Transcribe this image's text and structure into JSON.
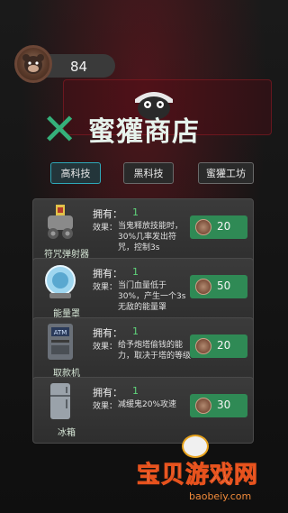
{
  "coins": {
    "value": "84"
  },
  "shop": {
    "title": "蜜獾商店"
  },
  "tabs": [
    {
      "label": "高科技",
      "active": true
    },
    {
      "label": "黑科技",
      "active": false
    },
    {
      "label": "蜜獾工坊",
      "active": false
    }
  ],
  "items": [
    {
      "name": "符咒弹射器",
      "icon": "talisman-launcher-icon",
      "own_label": "拥有：",
      "own_value": "1",
      "effect_label": "效果：",
      "effect_text": "当鬼释放技能时，30%几率发出符咒，控制3s",
      "price": "20"
    },
    {
      "name": "能量罩",
      "icon": "energy-shield-icon",
      "own_label": "拥有：",
      "own_value": "1",
      "effect_label": "效果：",
      "effect_text": "当门血量低于30%，产生一个3s无敌的能量罩",
      "price": "50"
    },
    {
      "name": "取款机",
      "icon": "atm-icon",
      "own_label": "拥有：",
      "own_value": "1",
      "effect_label": "效果：",
      "effect_text": "给予炮塔偷钱的能力，取决于塔的等级",
      "price": "20"
    },
    {
      "name": "冰箱",
      "icon": "fridge-icon",
      "own_label": "拥有：",
      "own_value": "1",
      "effect_label": "效果：",
      "effect_text": "减缓鬼20%攻速",
      "price": "30"
    }
  ],
  "watermark": {
    "text": "宝贝游戏网",
    "url": "baobeiy.com"
  },
  "colors": {
    "accent_green": "#35b07a",
    "buy_button": "#2f8a55",
    "own_value": "#5fd37a",
    "active_tab_border": "#2ea8b8"
  }
}
